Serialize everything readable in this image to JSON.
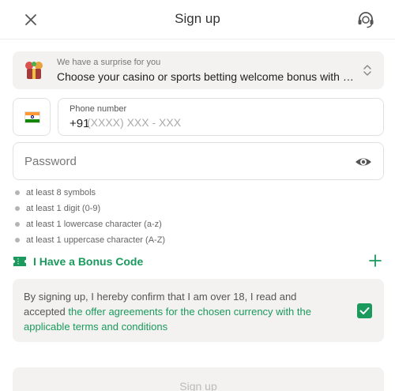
{
  "header": {
    "title": "Sign up",
    "close_icon": "close-icon",
    "support_icon": "headset-icon"
  },
  "bonus": {
    "hint": "We have a surprise for you",
    "value": "Choose your casino or sports betting welcome bonus with your first deposit",
    "icon": "gift-image",
    "chevron_icon": "chevron-up-down-icon"
  },
  "phone": {
    "country_flag": "india-flag-icon",
    "label": "Phone number",
    "prefix": "+91",
    "placeholder": "(XXXX) XXX - XXX",
    "value": ""
  },
  "password": {
    "placeholder": "Password",
    "value": "",
    "toggle_icon": "eye-icon"
  },
  "password_rules": [
    "at least 8 symbols",
    "at least 1 digit (0-9)",
    "at least 1 lowercase character (a-z)",
    "at least 1 uppercase character (A-Z)"
  ],
  "bonus_code": {
    "label": "I Have a Bonus Code",
    "icon": "ticket-icon",
    "toggle_icon": "plus-icon"
  },
  "consent": {
    "text": "By signing up, I hereby confirm that I am over 18, I read and accepted ",
    "link": "the offer agreements for the chosen currency with the applicable terms and conditions",
    "checked": true
  },
  "submit": {
    "label": "Sign up",
    "disabled": true
  },
  "colors": {
    "accent": "#1a9a5c",
    "field_bg": "#f3f2f0",
    "border": "#e1e1e1"
  }
}
